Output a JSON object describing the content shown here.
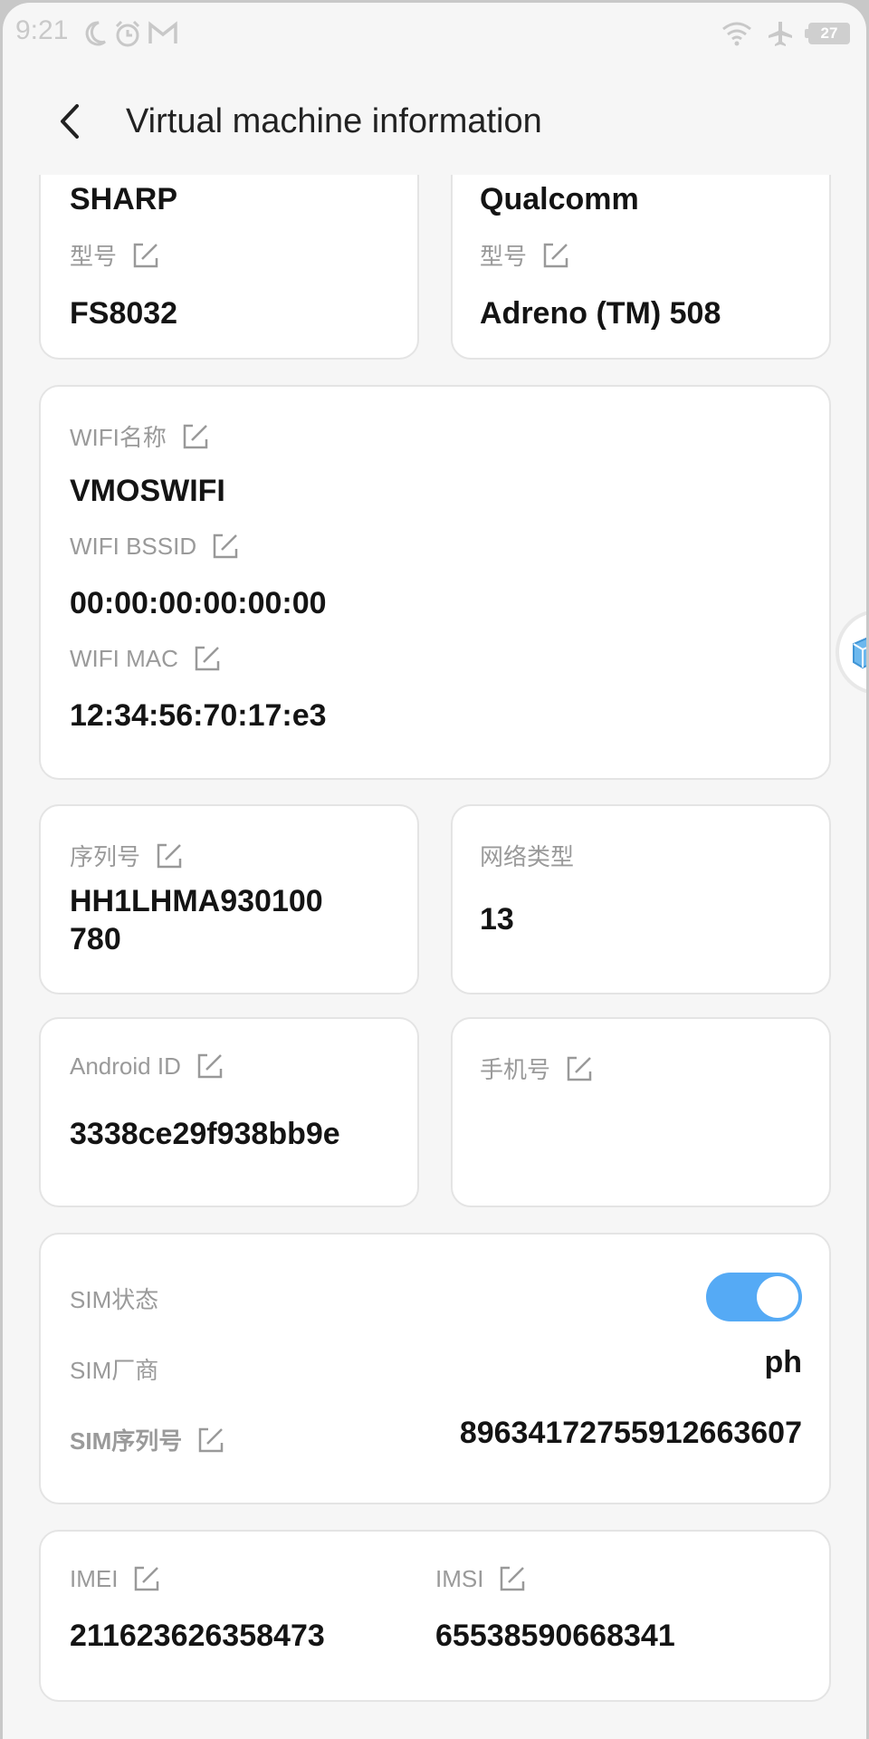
{
  "status_bar": {
    "time": "9:21",
    "battery": "27"
  },
  "header": {
    "title": "Virtual machine information"
  },
  "cards": {
    "device": {
      "brand_value": "SHARP",
      "model_label": "型号",
      "model_value": "FS8032"
    },
    "gpu": {
      "vendor_value": "Qualcomm",
      "model_label": "型号",
      "model_value": "Adreno (TM) 508"
    },
    "wifi": {
      "name_label": "WIFI名称",
      "name_value": "VMOSWIFI",
      "bssid_label": "WIFI BSSID",
      "bssid_value": "00:00:00:00:00:00",
      "mac_label": "WIFI MAC",
      "mac_value": "12:34:56:70:17:e3"
    },
    "serial": {
      "label": "序列号",
      "value_line1": "HH1LHMA930100",
      "value_line2": "780"
    },
    "network": {
      "label": "网络类型",
      "value": "13"
    },
    "android_id": {
      "label": "Android ID",
      "value": "3338ce29f938bb9e"
    },
    "phone": {
      "label": "手机号",
      "value": ""
    },
    "sim": {
      "status_label": "SIM状态",
      "status_on": true,
      "vendor_label": "SIM厂商",
      "vendor_value": "ph",
      "serial_label": "SIM序列号",
      "serial_value": "89634172755912663607"
    },
    "imei_imsi": {
      "imei_label": "IMEI",
      "imei_value": "211623626358473",
      "imsi_label": "IMSI",
      "imsi_value": "65538590668341"
    }
  },
  "colors": {
    "toggle_on": "#55aaf5",
    "label": "#9a9a9a",
    "value": "#141414",
    "card_border": "#e4e4e4"
  }
}
